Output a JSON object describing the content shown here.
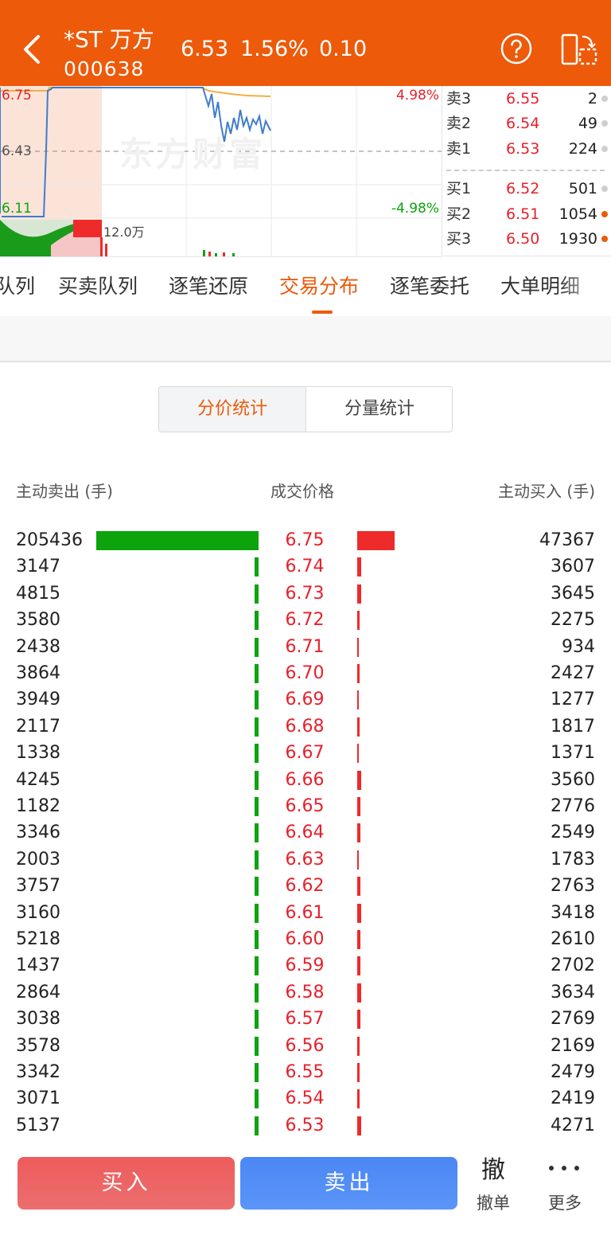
{
  "header": {
    "name": "*ST 万方",
    "code": "000638",
    "price": "6.53",
    "change_pct": "1.56%",
    "change": "0.10"
  },
  "chart": {
    "high_label": "6.75",
    "mid_label": "6.43",
    "low_label": "6.11",
    "up_pct": "4.98%",
    "down_pct": "-4.98%",
    "vol_label": "12.0万",
    "watermark": "东方财富"
  },
  "orderbook": [
    {
      "label": "卖3",
      "price": "6.55",
      "vol": "2",
      "dot": "#cfcfcf"
    },
    {
      "label": "卖2",
      "price": "6.54",
      "vol": "49",
      "dot": "#cfcfcf"
    },
    {
      "label": "卖1",
      "price": "6.53",
      "vol": "224",
      "dot": "#cfcfcf"
    },
    {
      "label": "买1",
      "price": "6.52",
      "vol": "501",
      "dot": "#cfcfcf"
    },
    {
      "label": "买2",
      "price": "6.51",
      "vol": "1054",
      "dot": "#ec5a0a"
    },
    {
      "label": "买3",
      "price": "6.50",
      "vol": "1930",
      "dot": "#ec5a0a"
    }
  ],
  "tabs": [
    "队列",
    "买卖队列",
    "逐笔还原",
    "交易分布",
    "逐笔委托",
    "大单明细"
  ],
  "segment": {
    "price_stats": "分价统计",
    "volume_stats": "分量统计"
  },
  "columns": {
    "sell": "主动卖出 (手)",
    "price": "成交价格",
    "buy": "主动买入 (手)"
  },
  "rows": [
    {
      "sell": "205436",
      "price": "6.75",
      "buy": "47367"
    },
    {
      "sell": "3147",
      "price": "6.74",
      "buy": "3607"
    },
    {
      "sell": "4815",
      "price": "6.73",
      "buy": "3645"
    },
    {
      "sell": "3580",
      "price": "6.72",
      "buy": "2275"
    },
    {
      "sell": "2438",
      "price": "6.71",
      "buy": "934"
    },
    {
      "sell": "3864",
      "price": "6.70",
      "buy": "2427"
    },
    {
      "sell": "3949",
      "price": "6.69",
      "buy": "1277"
    },
    {
      "sell": "2117",
      "price": "6.68",
      "buy": "1817"
    },
    {
      "sell": "1338",
      "price": "6.67",
      "buy": "1371"
    },
    {
      "sell": "4245",
      "price": "6.66",
      "buy": "3560"
    },
    {
      "sell": "1182",
      "price": "6.65",
      "buy": "2776"
    },
    {
      "sell": "3346",
      "price": "6.64",
      "buy": "2549"
    },
    {
      "sell": "2003",
      "price": "6.63",
      "buy": "1783"
    },
    {
      "sell": "3757",
      "price": "6.62",
      "buy": "2763"
    },
    {
      "sell": "3160",
      "price": "6.61",
      "buy": "3418"
    },
    {
      "sell": "5218",
      "price": "6.60",
      "buy": "2610"
    },
    {
      "sell": "1437",
      "price": "6.59",
      "buy": "2702"
    },
    {
      "sell": "2864",
      "price": "6.58",
      "buy": "3634"
    },
    {
      "sell": "3038",
      "price": "6.57",
      "buy": "2769"
    },
    {
      "sell": "3578",
      "price": "6.56",
      "buy": "2169"
    },
    {
      "sell": "3342",
      "price": "6.55",
      "buy": "2479"
    },
    {
      "sell": "3071",
      "price": "6.54",
      "buy": "2419"
    },
    {
      "sell": "5137",
      "price": "6.53",
      "buy": "4271"
    }
  ],
  "bottom": {
    "buy": "买入",
    "sell": "卖出",
    "cancel_icon": "撤",
    "cancel": "撤单",
    "more": "更多"
  },
  "colors": {
    "header": "#ec5a0a",
    "sell_bar": "#0ca30c",
    "buy_bar": "#ee2a2a",
    "price_text": "#e6212b"
  }
}
